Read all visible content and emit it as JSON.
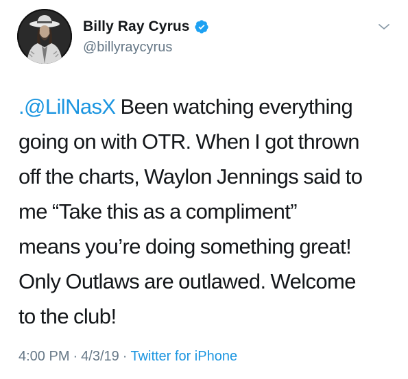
{
  "author": {
    "display_name": "Billy Ray Cyrus",
    "handle": "@billyraycyrus",
    "verified": true
  },
  "tweet": {
    "mention": ".@LilNasX",
    "lines": [
      " Been watching everything",
      "going on with OTR. When I got thrown",
      "off the charts, Waylon Jennings said to",
      "me “Take this as a compliment”",
      "means you’re doing something great!",
      "Only Outlaws are outlawed. Welcome",
      "to the club!"
    ]
  },
  "meta": {
    "time": "4:00 PM",
    "separator": "·",
    "date": "4/3/19",
    "source": "Twitter for iPhone"
  },
  "icons": {
    "verified": "verified-badge-icon",
    "menu": "chevron-down-icon"
  },
  "colors": {
    "link": "#1b95e0",
    "secondary": "#657786",
    "text": "#14171a"
  }
}
